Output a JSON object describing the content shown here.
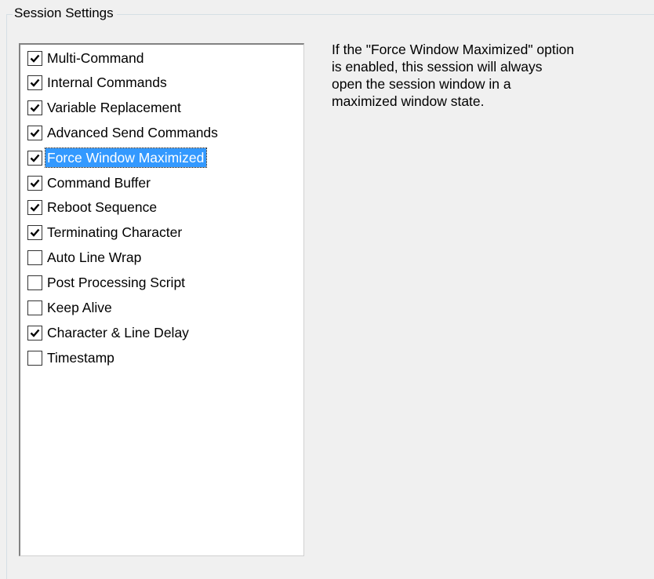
{
  "group": {
    "title": "Session Settings"
  },
  "options": [
    {
      "label": "Multi-Command",
      "checked": true,
      "selected": false
    },
    {
      "label": "Internal Commands",
      "checked": true,
      "selected": false
    },
    {
      "label": "Variable Replacement",
      "checked": true,
      "selected": false
    },
    {
      "label": "Advanced Send Commands",
      "checked": true,
      "selected": false
    },
    {
      "label": "Force Window Maximized",
      "checked": true,
      "selected": true
    },
    {
      "label": "Command Buffer",
      "checked": true,
      "selected": false
    },
    {
      "label": "Reboot Sequence",
      "checked": true,
      "selected": false
    },
    {
      "label": "Terminating Character",
      "checked": true,
      "selected": false
    },
    {
      "label": "Auto Line Wrap",
      "checked": false,
      "selected": false
    },
    {
      "label": "Post Processing Script",
      "checked": false,
      "selected": false
    },
    {
      "label": "Keep Alive",
      "checked": false,
      "selected": false
    },
    {
      "label": "Character & Line Delay",
      "checked": true,
      "selected": false
    },
    {
      "label": "Timestamp",
      "checked": false,
      "selected": false
    }
  ],
  "description": {
    "text": "If the \"Force Window Maximized\" option\nis enabled, this session will always\nopen the session window in a\nmaximized window state."
  },
  "colors": {
    "background": "#f0f0f0",
    "selection": "#3399ff",
    "list_background": "#ffffff"
  }
}
